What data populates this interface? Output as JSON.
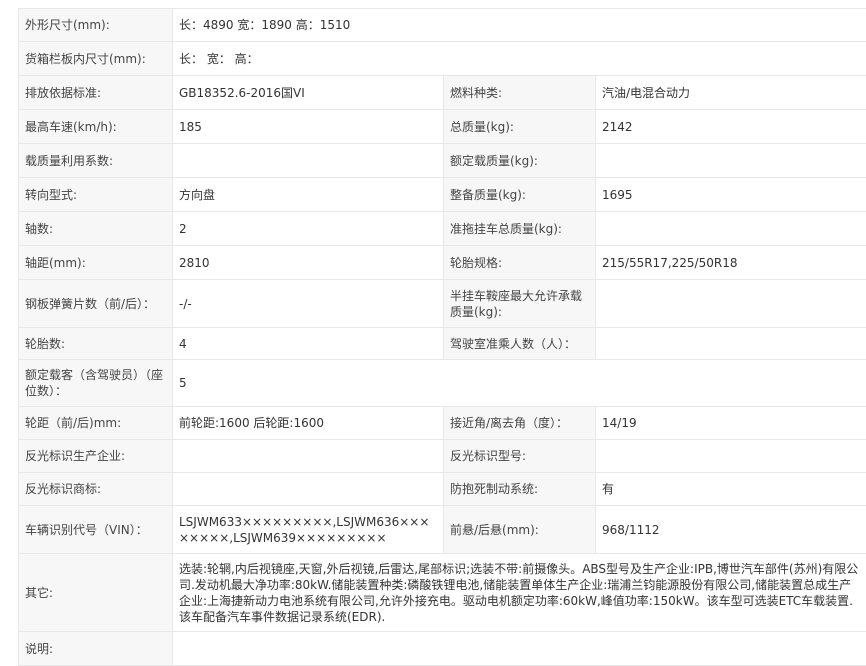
{
  "rows": [
    {
      "cells": [
        {
          "label": "外形尺寸(mm):",
          "value": "长：4890 宽：1890 高：1510"
        }
      ]
    },
    {
      "cells": [
        {
          "label": "货箱栏板内尺寸(mm):",
          "value": "长：  宽：  高："
        }
      ]
    },
    {
      "cells": [
        {
          "label": "排放依据标准:",
          "value": "GB18352.6-2016国VI"
        },
        {
          "label": "燃料种类:",
          "value": "汽油/电混合动力"
        }
      ]
    },
    {
      "cells": [
        {
          "label": "最高车速(km/h):",
          "value": "185"
        },
        {
          "label": "总质量(kg):",
          "value": "2142"
        }
      ]
    },
    {
      "cells": [
        {
          "label": "载质量利用系数:",
          "value": ""
        },
        {
          "label": "额定载质量(kg):",
          "value": ""
        }
      ]
    },
    {
      "cells": [
        {
          "label": "转向型式:",
          "value": "方向盘"
        },
        {
          "label": "整备质量(kg):",
          "value": "1695"
        }
      ]
    },
    {
      "cells": [
        {
          "label": "轴数:",
          "value": "2"
        },
        {
          "label": "准拖挂车总质量(kg):",
          "value": ""
        }
      ]
    },
    {
      "cells": [
        {
          "label": "轴距(mm):",
          "value": "2810"
        },
        {
          "label": "轮胎规格:",
          "value": "215/55R17,225/50R18"
        }
      ]
    },
    {
      "cells": [
        {
          "label": "钢板弹簧片数（前/后）：",
          "value": "-/-"
        },
        {
          "label": "半挂车鞍座最大允许承载质量(kg):",
          "value": ""
        }
      ]
    },
    {
      "cells": [
        {
          "label": "轮胎数:",
          "value": "4"
        },
        {
          "label": "驾驶室准乘人数（人）：",
          "value": ""
        }
      ]
    },
    {
      "cells": [
        {
          "label": "额定载客（含驾驶员）（座位数）：",
          "value": "5"
        }
      ]
    },
    {
      "cells": [
        {
          "label": "轮距（前/后)mm:",
          "value": "前轮距:1600 后轮距:1600"
        },
        {
          "label": "接近角/离去角（度）：",
          "value": "14/19"
        }
      ]
    },
    {
      "cells": [
        {
          "label": "反光标识生产企业:",
          "value": ""
        },
        {
          "label": "反光标识型号:",
          "value": ""
        }
      ]
    },
    {
      "cells": [
        {
          "label": "反光标识商标:",
          "value": ""
        },
        {
          "label": "防抱死制动系统:",
          "value": "有"
        }
      ]
    },
    {
      "cells": [
        {
          "label": "车辆识别代号（VIN）：",
          "value": "LSJWM633×××××××××,LSJWM636××××××××,LSJWM639×××××××××"
        },
        {
          "label": "前悬/后悬(mm):",
          "value": "968/1112"
        }
      ]
    },
    {
      "cells": [
        {
          "label": "其它:",
          "value": "选装:轮辋,内后视镜座,天窗,外后视镜,后雷达,尾部标识;选装不带:前摄像头。ABS型号及生产企业:IPB,博世汽车部件(苏州)有限公司.发动机最大净功率:80kW.储能装置种类:磷酸铁锂电池,储能装置单体生产企业:瑞浦兰钧能源股份有限公司,储能装置总成生产企业:上海捷新动力电池系统有限公司,允许外接充电。驱动电机额定功率:60kW,峰值功率:150kW。该车型可选装ETC车载装置.该车配备汽车事件数据记录系统(EDR)."
        }
      ]
    },
    {
      "cells": [
        {
          "label": "说明:",
          "value": ""
        }
      ]
    }
  ]
}
